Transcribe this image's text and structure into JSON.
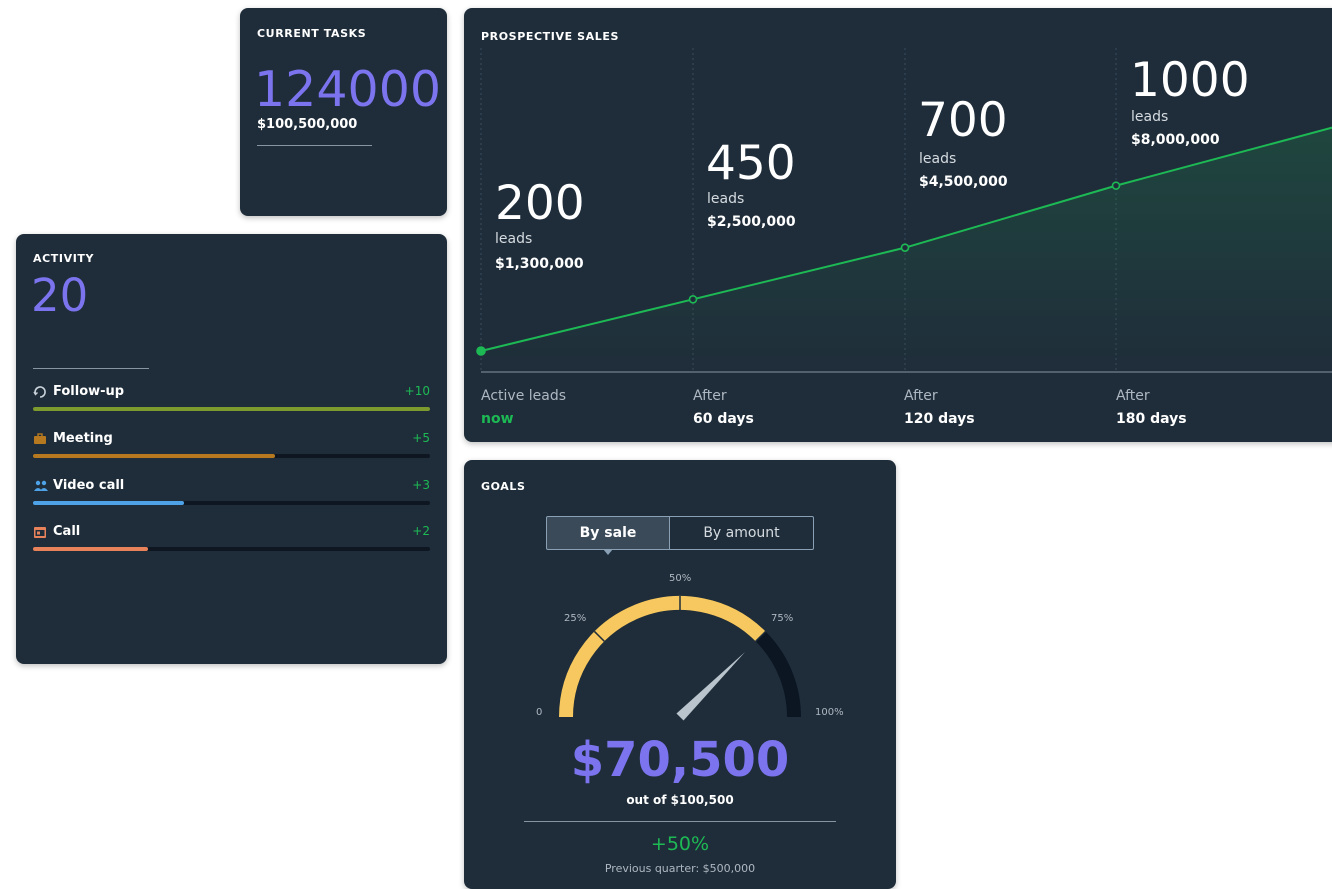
{
  "colors": {
    "card_bg": "#1f2d3a",
    "accent_purple": "#7b74ee",
    "positive_green": "#1db954",
    "gauge_yellow": "#f6c85f",
    "gauge_track": "#0b1622"
  },
  "current_tasks": {
    "title": "CURRENT TASKS",
    "value": "124000",
    "amount": "$100,500,000"
  },
  "activity": {
    "title": "ACTIVITY",
    "value": "20",
    "items": [
      {
        "icon": "follow-up-icon",
        "label": "Follow-up",
        "delta": "+10",
        "progress": 1.0,
        "color": "#7d9a2e"
      },
      {
        "icon": "meeting-icon",
        "label": "Meeting",
        "delta": "+5",
        "progress": 0.61,
        "color": "#b7791f"
      },
      {
        "icon": "video-call-icon",
        "label": "Video call",
        "delta": "+3",
        "progress": 0.38,
        "color": "#4ea3e8"
      },
      {
        "icon": "call-icon",
        "label": "Call",
        "delta": "+2",
        "progress": 0.29,
        "color": "#e8825a"
      }
    ]
  },
  "prospective_sales": {
    "title": "PROSPECTIVE SALES",
    "columns": [
      {
        "value": "200",
        "unit": "leads",
        "amount": "$1,300,000",
        "axis_label": "Active leads",
        "axis_value": "now"
      },
      {
        "value": "450",
        "unit": "leads",
        "amount": "$2,500,000",
        "axis_label": "After",
        "axis_value": "60 days"
      },
      {
        "value": "700",
        "unit": "leads",
        "amount": "$4,500,000",
        "axis_label": "After",
        "axis_value": "120 days"
      },
      {
        "value": "1000",
        "unit": "leads",
        "amount": "$8,000,000",
        "axis_label": "After",
        "axis_value": "180 days"
      }
    ]
  },
  "goals": {
    "title": "GOALS",
    "toggle": {
      "selected": "By sale",
      "other": "By amount"
    },
    "ticks": [
      "0",
      "25%",
      "50%",
      "75%",
      "100%"
    ],
    "progress": 0.75,
    "value": "$70,500",
    "out_of": "out of $100,500",
    "change": "+50%",
    "previous": "Previous quarter: $500,000"
  },
  "chart_data": {
    "type": "line",
    "title": "PROSPECTIVE SALES",
    "x": [
      "now",
      "60 days",
      "120 days",
      "180 days"
    ],
    "series": [
      {
        "values": [
          200,
          450,
          700,
          1000
        ]
      }
    ]
  }
}
